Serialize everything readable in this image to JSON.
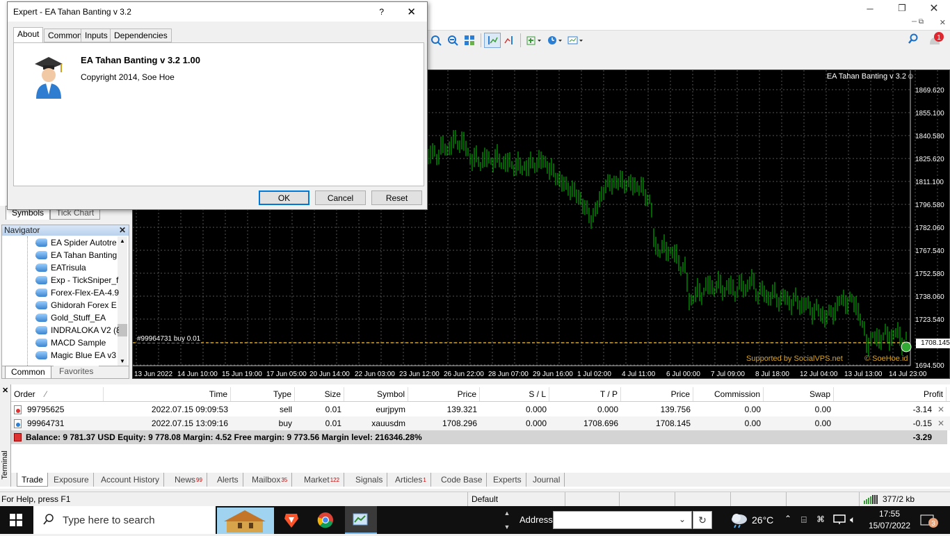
{
  "dialog": {
    "title": "Expert - EA Tahan Banting v 3.2",
    "help": "?",
    "close": "✕",
    "tabs": [
      "About",
      "Common",
      "Inputs",
      "Dependencies"
    ],
    "ea_name": "EA Tahan Banting v 3.2 1.00",
    "copyright": "Copyright 2014, Soe Hoe",
    "ok": "OK",
    "cancel": "Cancel",
    "reset": "Reset"
  },
  "market_watch_tabs": [
    "Symbols",
    "Tick Chart"
  ],
  "navigator": {
    "title": "Navigator",
    "items": [
      "EA Spider Autotre",
      "EA Tahan Banting",
      "EATrisula",
      "Exp - TickSniper_f",
      "Forex-Flex-EA-4.9",
      "Ghidorah Forex E",
      "Gold_Stuff_EA",
      "INDRALOKA V2 (8",
      "MACD Sample",
      "Magic Blue EA v3"
    ],
    "tabs": [
      "Common",
      "Favorites"
    ]
  },
  "chart": {
    "header": "EA Tahan Banting v 3.2",
    "price_levels": [
      "1869.620",
      "1855.100",
      "1840.580",
      "1825.620",
      "1811.100",
      "1796.580",
      "1782.060",
      "1767.540",
      "1752.580",
      "1738.060",
      "1723.540",
      "1708.145",
      "1694.500"
    ],
    "current_price": "1708.145",
    "time_labels": [
      "13 Jun 2022",
      "14 Jun 10:00",
      "15 Jun 19:00",
      "17 Jun 05:00",
      "20 Jun 14:00",
      "22 Jun 03:00",
      "23 Jun 12:00",
      "26 Jun 22:00",
      "28 Jun 07:00",
      "29 Jun 16:00",
      "1 Jul 02:00",
      "4 Jul 11:00",
      "6 Jul 00:00",
      "7 Jul 09:00",
      "8 Jul 18:00",
      "12 Jul 04:00",
      "13 Jul 13:00",
      "14 Jul 23:00"
    ],
    "order_label": "#99964731 buy 0.01",
    "supported": "Supported by SocialVPS.net",
    "author": "© SoeHoe.id",
    "colors": {
      "bars": "#00c800",
      "background": "#000000",
      "order_line": "#daa520"
    }
  },
  "terminal": {
    "side_label": "Terminal",
    "columns": [
      "Order",
      "Time",
      "Type",
      "Size",
      "Symbol",
      "Price",
      "S / L",
      "T / P",
      "Price",
      "Commission",
      "Swap",
      "Profit"
    ],
    "rows": [
      {
        "order": "99795625",
        "time": "2022.07.15 09:09:53",
        "type": "sell",
        "size": "0.01",
        "symbol": "eurjpym",
        "price": "139.321",
        "sl": "0.000",
        "tp": "0.000",
        "cur_price": "139.756",
        "commission": "0.00",
        "swap": "0.00",
        "profit": "-3.14"
      },
      {
        "order": "99964731",
        "time": "2022.07.15 13:09:16",
        "type": "buy",
        "size": "0.01",
        "symbol": "xauusdm",
        "price": "1708.296",
        "sl": "0.000",
        "tp": "1708.696",
        "cur_price": "1708.145",
        "commission": "0.00",
        "swap": "0.00",
        "profit": "-0.15"
      }
    ],
    "summary": "Balance: 9 781.37 USD  Equity: 9 778.08  Margin: 4.52  Free margin: 9 773.56  Margin level: 216346.28%",
    "summary_profit": "-3.29",
    "tabs": [
      {
        "label": "Trade",
        "badge": ""
      },
      {
        "label": "Exposure",
        "badge": ""
      },
      {
        "label": "Account History",
        "badge": ""
      },
      {
        "label": "News",
        "badge": "99"
      },
      {
        "label": "Alerts",
        "badge": ""
      },
      {
        "label": "Mailbox",
        "badge": "35"
      },
      {
        "label": "Market",
        "badge": "122"
      },
      {
        "label": "Signals",
        "badge": ""
      },
      {
        "label": "Articles",
        "badge": "1"
      },
      {
        "label": "Code Base",
        "badge": ""
      },
      {
        "label": "Experts",
        "badge": ""
      },
      {
        "label": "Journal",
        "badge": ""
      }
    ]
  },
  "statusbar": {
    "help": "For Help, press F1",
    "profile": "Default",
    "traffic": "377/2 kb"
  },
  "taskbar": {
    "search_placeholder": "Type here to search",
    "address_label": "Address",
    "temperature": "26°C",
    "time": "17:55",
    "date": "15/07/2022"
  }
}
